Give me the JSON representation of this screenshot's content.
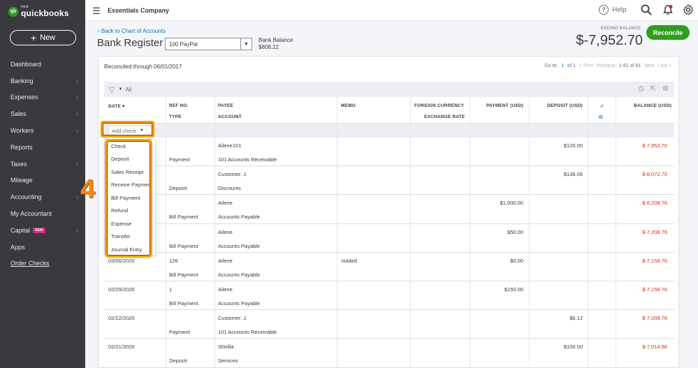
{
  "brand": {
    "intuit": "intuit",
    "name": "quickbooks",
    "mark": "qb"
  },
  "sidebar": {
    "new_label": "New",
    "items": [
      {
        "label": "Dashboard",
        "chevron": false
      },
      {
        "label": "Banking",
        "chevron": true
      },
      {
        "label": "Expenses",
        "chevron": true
      },
      {
        "label": "Sales",
        "chevron": true
      },
      {
        "label": "Workers",
        "chevron": true
      },
      {
        "label": "Reports",
        "chevron": false
      },
      {
        "label": "Taxes",
        "chevron": true
      },
      {
        "label": "Mileage",
        "chevron": false
      },
      {
        "label": "Accounting",
        "chevron": true
      },
      {
        "label": "My Accountant",
        "chevron": false
      },
      {
        "label": "Capital",
        "chevron": true,
        "badge": "NEW"
      },
      {
        "label": "Apps",
        "chevron": false
      },
      {
        "label": "Order Checks",
        "chevron": false
      }
    ]
  },
  "topbar": {
    "company": "Essentials Company",
    "help": "Help"
  },
  "header": {
    "back_link": "Back to Chart of Accounts",
    "title": "Bank Register",
    "account": "100 PayPal",
    "bank_balance_label": "Bank Balance",
    "bank_balance_value": "$808.22",
    "ending_balance_label": "ENDING BALANCE",
    "ending_balance_value": "$-7,952.70",
    "reconcile_label": "Reconcile"
  },
  "register": {
    "reconciled_text": "Reconciled through 06/01/2017",
    "pager": {
      "goto": "Go to:",
      "page": "1",
      "of": "of 1",
      "first": "< First",
      "previous": "Previous",
      "range": "1-81 of 81",
      "next": "Next",
      "last": "Last >"
    },
    "filter_label": "All",
    "columns": {
      "date": "DATE ▾",
      "ref": "REF NO.",
      "type": "TYPE",
      "payee": "PAYEE",
      "account": "ACCOUNT",
      "memo": "MEMO",
      "fc1": "FOREIGN CURRENCY",
      "fc2": "EXCHANGE RATE",
      "payment": "PAYMENT (USD)",
      "deposit": "DEPOSIT (USD)",
      "check": "✓",
      "balance": "BALANCE (USD)"
    },
    "add_check_label": "Add check",
    "rows": [
      {
        "date": "",
        "ref": "",
        "type": "Payment",
        "payee": "Ailene101",
        "account": "101 Accounts Receivable",
        "memo": "",
        "payment": "",
        "deposit": "$120.00",
        "balance": "$-7,952.70"
      },
      {
        "date": "",
        "ref": "",
        "type": "Deposit",
        "payee": "Customer .1",
        "account": "Discounts",
        "memo": "",
        "payment": "",
        "deposit": "$136.06",
        "balance": "$-8,072.70"
      },
      {
        "date": "",
        "ref": "",
        "type": "Bill Payment",
        "payee": "Ailene",
        "account": "Accounts Payable",
        "memo": "",
        "payment": "$1,000.00",
        "deposit": "",
        "balance": "$-8,208.76"
      },
      {
        "date": "",
        "ref": "",
        "type": "Bill Payment",
        "payee": "Ailene",
        "account": "Accounts Payable",
        "memo": "",
        "payment": "$50.00",
        "deposit": "",
        "balance": "$-7,208.76"
      },
      {
        "date": "03/06/2020",
        "ref": "126",
        "type": "Bill Payment",
        "payee": "Ailene",
        "account": "Accounts Payable",
        "memo": "Voided",
        "payment": "$0.00",
        "deposit": "",
        "balance": "$-7,158.76"
      },
      {
        "date": "02/29/2020",
        "ref": "1",
        "type": "Bill Payment",
        "payee": "Ailene",
        "account": "Accounts Payable",
        "memo": "",
        "payment": "$150.00",
        "deposit": "",
        "balance": "$-7,158.76"
      },
      {
        "date": "02/22/2020",
        "ref": "",
        "type": "Payment",
        "payee": "Customer .1",
        "account": "101 Accounts Receivable",
        "memo": "",
        "payment": "",
        "deposit": "$6.12",
        "balance": "$-7,008.76"
      },
      {
        "date": "02/21/2020",
        "ref": "",
        "type": "Deposit",
        "payee": "Sheilla",
        "account": "Services",
        "memo": "",
        "payment": "",
        "deposit": "$100.00",
        "balance": "$-7,014.88"
      }
    ]
  },
  "dropdown": {
    "items": [
      "Check",
      "Deposit",
      "Sales Receipt",
      "Receive Payment",
      "Bill Payment",
      "Refund",
      "Expense",
      "Transfer",
      "Journal Entry"
    ]
  },
  "annotation": {
    "step": "4"
  },
  "colors": {
    "sidebar": "#393a3d",
    "brand_green": "#2ca01c",
    "link": "#0077c5",
    "negative": "#d52b1e",
    "highlight": "#f0a500"
  }
}
